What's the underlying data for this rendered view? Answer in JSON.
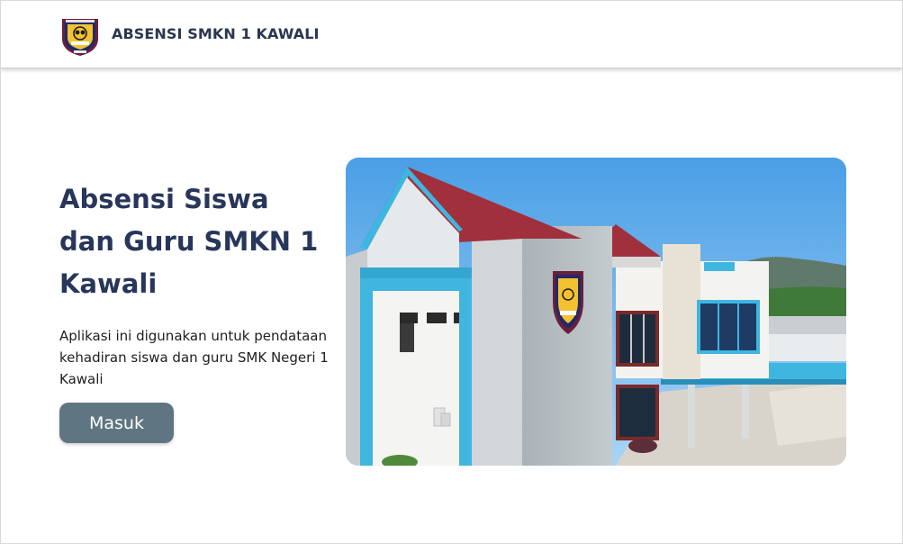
{
  "header": {
    "brand": "ABSENSI SMKN 1 KAWALI",
    "logo_icon": "school-emblem-icon"
  },
  "hero": {
    "title": "Absensi Siswa dan Guru SMKN 1 Kawali",
    "description": "Aplikasi ini digunakan untuk pendataan kehadiran siswa dan guru SMK Negeri 1 Kawali",
    "login_button": "Masuk",
    "image": "school-building-photo"
  },
  "colors": {
    "title": "#27365a",
    "brand": "#2c3650",
    "button": "#5f7682",
    "building_accent": "#3fb6e0",
    "roof": "#9b2e3a"
  }
}
